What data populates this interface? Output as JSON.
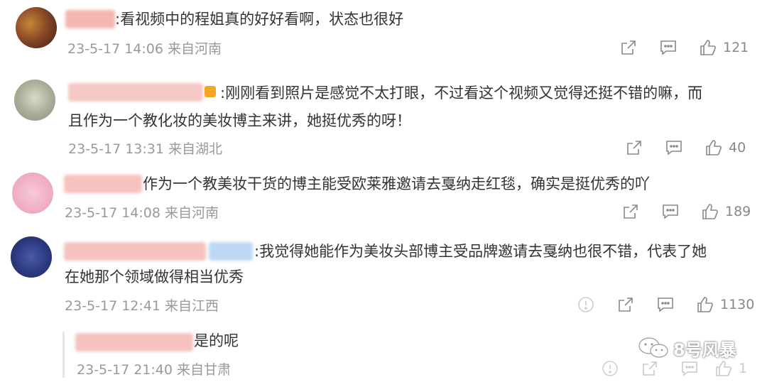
{
  "comments": [
    {
      "text": ":看视频中的程姐真的好好看啊，状态也很好",
      "time": "23-5-17 14:06 来自河南",
      "likes": "121"
    },
    {
      "text_line1": ":刚刚看到照片是感觉不太打眼，不过看这个视频又觉得还挺不错的嘛，而",
      "text_line2": "且作为一个教化妆的美妆博主来讲，她挺优秀的呀！",
      "time": "23-5-17 13:31 来自湖北",
      "likes": "40"
    },
    {
      "text": "作为一个教美妆干货的博主能受欧莱雅邀请去戛纳走红毯，确实是挺优秀的吖",
      "time": "23-5-17 14:08 来自河南",
      "likes": "189"
    },
    {
      "text_line1": ":我觉得她能作为美妆头部博主受品牌邀请去戛纳也很不错，代表了她",
      "text_line2": "在她那个领域做得相当优秀",
      "time": "23-5-17 12:41 来自江西",
      "likes": "1130"
    }
  ],
  "reply": {
    "text": "是的呢",
    "time": "23-5-17 21:40 来自甘肃",
    "likes": "1"
  },
  "watermark": "8号风暴",
  "colors": {
    "text": "#333333",
    "meta": "#999999",
    "icon": "#888888"
  }
}
